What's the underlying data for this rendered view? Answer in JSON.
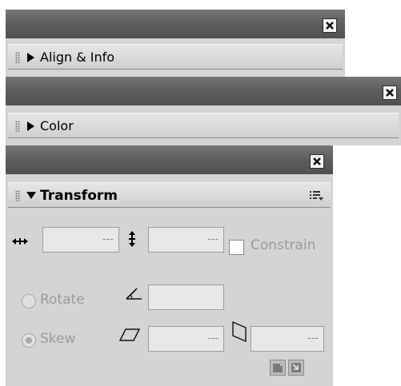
{
  "panels": {
    "align_info": {
      "title": "Align & Info",
      "expanded": false
    },
    "color": {
      "title": "Color",
      "expanded": false
    },
    "transform": {
      "title": "Transform",
      "expanded": true
    }
  },
  "transform": {
    "width_value": "---",
    "height_value": "---",
    "constrain_label": "Constrain",
    "constrain_checked": false,
    "rotate_label": "Rotate",
    "rotate_value": "",
    "skew_label": "Skew",
    "skew_h_value": "---",
    "skew_v_value": "---",
    "selected_mode": "Skew"
  },
  "icons": {
    "close": "close-icon",
    "collapsed": "triangle-right-icon",
    "expanded": "triangle-down-icon",
    "options": "panel-options-icon"
  }
}
